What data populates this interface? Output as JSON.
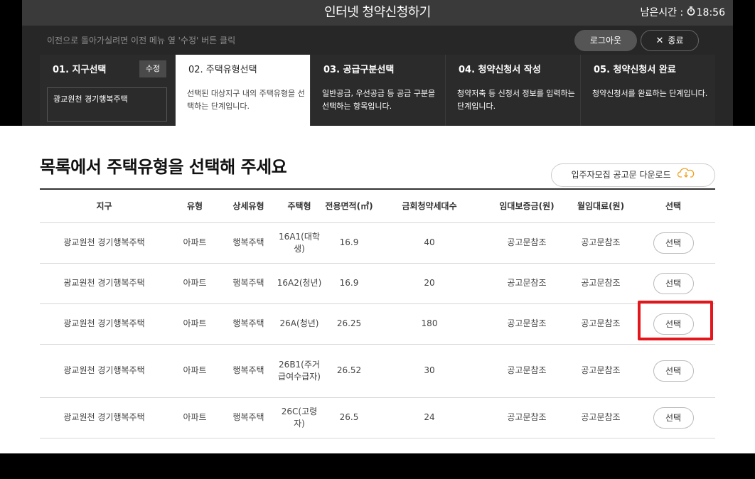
{
  "header": {
    "title": "인터넷 청약신청하기",
    "timer_label": "남은시간 :",
    "timer_value": "18:56"
  },
  "subbar": {
    "hint": "이전으로 돌아가실려면 이전 메뉴 옆 '수정' 버튼 클릭",
    "logout_label": "로그아웃",
    "close_label": "종료"
  },
  "steps": [
    {
      "title": "01. 지구선택",
      "edit_label": "수정",
      "selected_district": "광교원천 경기행복주택"
    },
    {
      "title": "02. 주택유형선택",
      "desc": "선택된 대상지구 내의 주택유형을 선택하는 단계입니다."
    },
    {
      "title": "03. 공급구분선택",
      "desc": "일반공급, 우선공급 등 공급 구분을 선택하는 항목입니다."
    },
    {
      "title": "04. 청약신청서 작성",
      "desc": "청약저축 등 신청서 정보를 입력하는 단계입니다."
    },
    {
      "title": "05. 청약신청서 완료",
      "desc": "청약신청서를 완료하는 단계입니다."
    }
  ],
  "main": {
    "title": "목록에서 주택유형을 선택해 주세요",
    "download_label": "입주자모집 공고문 다운로드"
  },
  "table": {
    "headers": [
      "지구",
      "유형",
      "상세유형",
      "주택형",
      "전용면적(㎡)",
      "금회청약세대수",
      "임대보증금(원)",
      "월임대료(원)",
      "선택"
    ],
    "rows": [
      {
        "district": "광교원천 경기행복주택",
        "type": "아파트",
        "detail": "행복주택",
        "house": "16A1(대학생)",
        "area": "16.9",
        "units": "40",
        "deposit": "공고문참조",
        "rent": "공고문참조",
        "select": "선택"
      },
      {
        "district": "광교원천 경기행복주택",
        "type": "아파트",
        "detail": "행복주택",
        "house": "16A2(청년)",
        "area": "16.9",
        "units": "20",
        "deposit": "공고문참조",
        "rent": "공고문참조",
        "select": "선택"
      },
      {
        "district": "광교원천 경기행복주택",
        "type": "아파트",
        "detail": "행복주택",
        "house": "26A(청년)",
        "area": "26.25",
        "units": "180",
        "deposit": "공고문참조",
        "rent": "공고문참조",
        "select": "선택"
      },
      {
        "district": "광교원천 경기행복주택",
        "type": "아파트",
        "detail": "행복주택",
        "house": "26B1(주거급여수급자)",
        "area": "26.52",
        "units": "30",
        "deposit": "공고문참조",
        "rent": "공고문참조",
        "select": "선택"
      },
      {
        "district": "광교원천 경기행복주택",
        "type": "아파트",
        "detail": "행복주택",
        "house": "26C(고령자)",
        "area": "26.5",
        "units": "24",
        "deposit": "공고문참조",
        "rent": "공고문참조",
        "select": "선택"
      }
    ]
  },
  "colors": {
    "header_bg": "#3a3a3a",
    "subbar_bg": "#272727",
    "highlight": "#e4161b"
  }
}
